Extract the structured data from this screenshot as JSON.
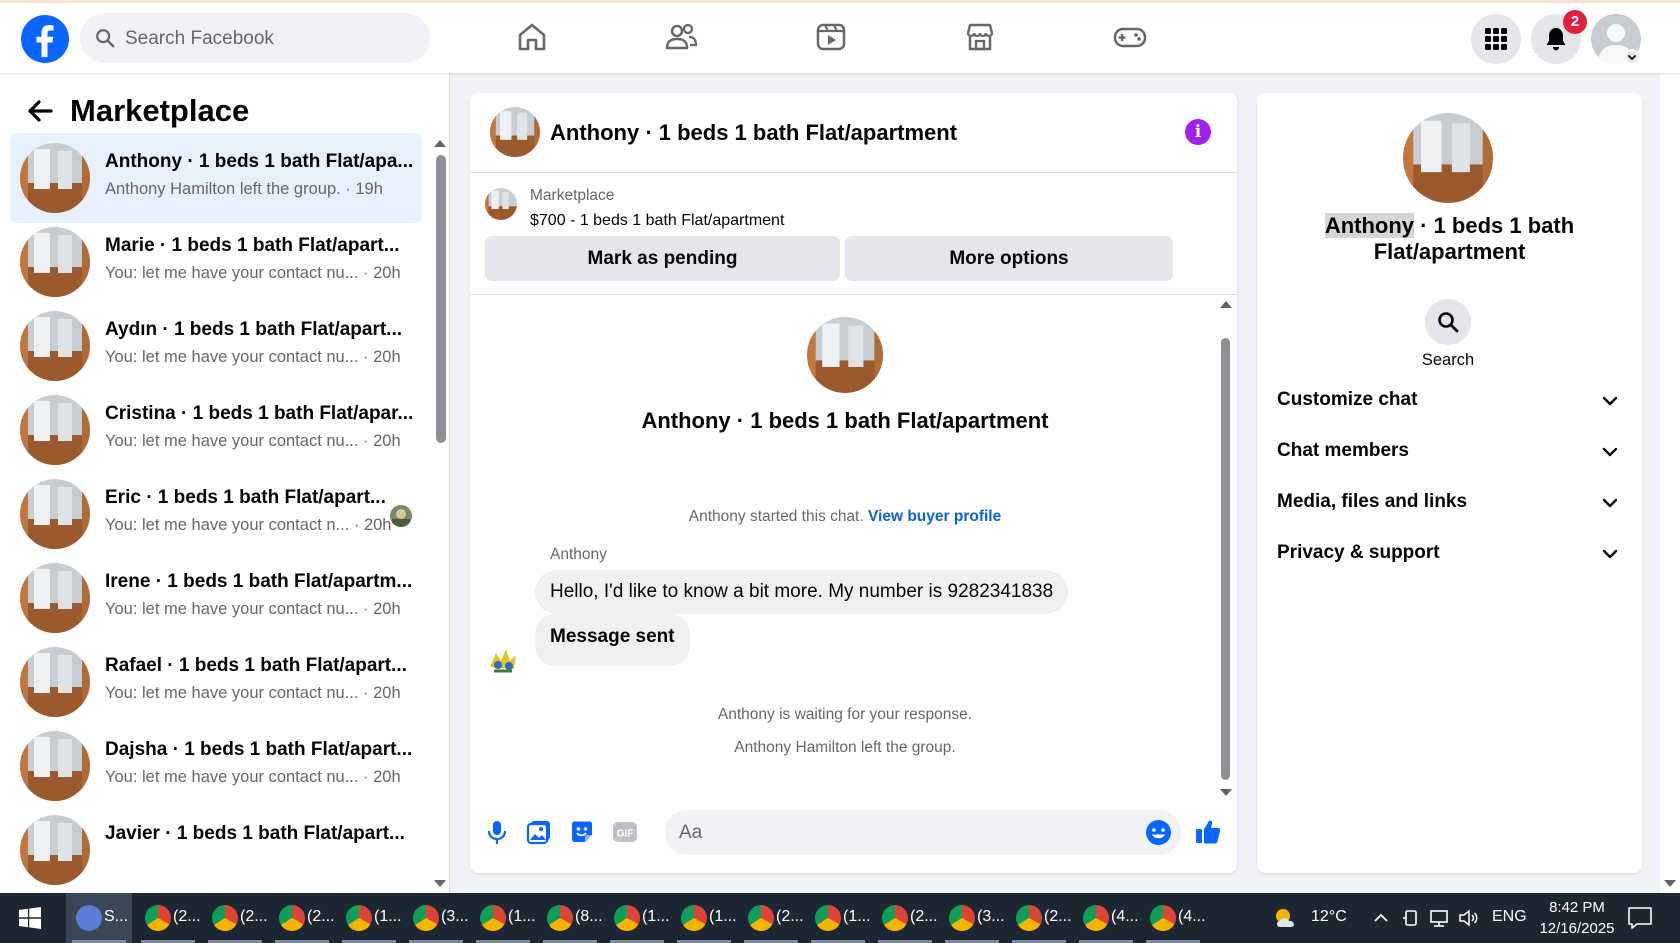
{
  "topbar": {
    "search_placeholder": "Search Facebook",
    "notifications_badge": "2",
    "nav_icons": [
      "home-icon",
      "friends-icon",
      "video-icon",
      "marketplace-icon",
      "gaming-icon"
    ]
  },
  "sidebar": {
    "title": "Marketplace",
    "conversations": [
      {
        "title": "Anthony · 1 beds 1 bath Flat/apa...",
        "preview": "Anthony Hamilton left the group. · 19h",
        "active": true
      },
      {
        "title": "Marie · 1 beds 1 bath Flat/apart...",
        "preview": "You: let me have your contact nu... · 20h"
      },
      {
        "title": "Aydın · 1 beds 1 bath Flat/apart...",
        "preview": "You: let me have your contact nu... · 20h"
      },
      {
        "title": "Cristina · 1 beds 1 bath Flat/apar...",
        "preview": "You: let me have your contact nu... · 20h"
      },
      {
        "title": "Eric · 1 beds 1 bath Flat/apart...",
        "preview": "You: let me have your contact n... · 20h"
      },
      {
        "title": "Irene · 1 beds 1 bath Flat/apartm...",
        "preview": "You: let me have your contact nu... · 20h"
      },
      {
        "title": "Rafael · 1 beds 1 bath Flat/apart...",
        "preview": "You: let me have your contact nu... · 20h"
      },
      {
        "title": "Dajsha · 1 beds 1 bath Flat/apart...",
        "preview": "You: let me have your contact nu... · 20h"
      },
      {
        "title": "Javier · 1 beds 1 bath Flat/apart...",
        "preview": ""
      }
    ]
  },
  "chat": {
    "header_title": "Anthony · 1 beds 1 bath Flat/apartment",
    "listing_label": "Marketplace",
    "listing_desc": "$700 - 1 beds 1 bath Flat/apartment",
    "mark_pending": "Mark as pending",
    "more_options": "More options",
    "center_title": "Anthony · 1 beds 1 bath Flat/apartment",
    "started_text": "Anthony started this chat.",
    "view_buyer_profile": "View buyer profile",
    "sender_name": "Anthony",
    "message_1": "Hello, I'd like to know a bit more. My number is 9282341838",
    "message_2": "Message sent",
    "waiting_text": "Anthony is waiting for your response.",
    "left_text": "Anthony Hamilton left the group.",
    "composer_placeholder": "Aa"
  },
  "details": {
    "title_highlight": "Anthony",
    "title_rest": " · 1 beds 1 bath Flat/apartment",
    "search_label": "Search",
    "sections": [
      "Customize chat",
      "Chat members",
      "Media, files and links",
      "Privacy & support"
    ]
  },
  "taskbar": {
    "apps": [
      "S...",
      "(2...",
      "(2...",
      "(2...",
      "(1...",
      "(3...",
      "(1...",
      "(8...",
      "(1...",
      "(1...",
      "(2...",
      "(1...",
      "(2...",
      "(3...",
      "(2...",
      "(4...",
      "(4..."
    ],
    "temperature": "12°C",
    "language": "ENG",
    "time": "8:42 PM",
    "date": "12/16/2025"
  },
  "colors": {
    "facebook_blue": "#0866ff",
    "active_row": "#e7f1fd",
    "info_purple": "#a020f0",
    "link_blue": "#0a64d8",
    "badge_red": "#e41e3f"
  }
}
